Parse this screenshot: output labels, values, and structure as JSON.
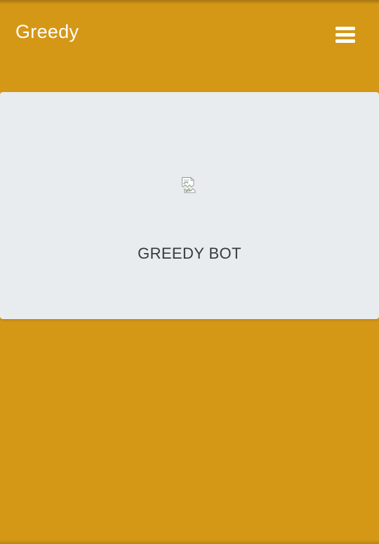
{
  "navbar": {
    "brand": "Greedy",
    "menu_icon": "hamburger-menu-icon"
  },
  "card": {
    "image_icon": "broken-image-icon",
    "title": "GREEDY BOT"
  },
  "colors": {
    "background": "#d59716",
    "card_background": "#e9ecef",
    "title_text": "#343a40",
    "brand_text": "#ffffff"
  }
}
